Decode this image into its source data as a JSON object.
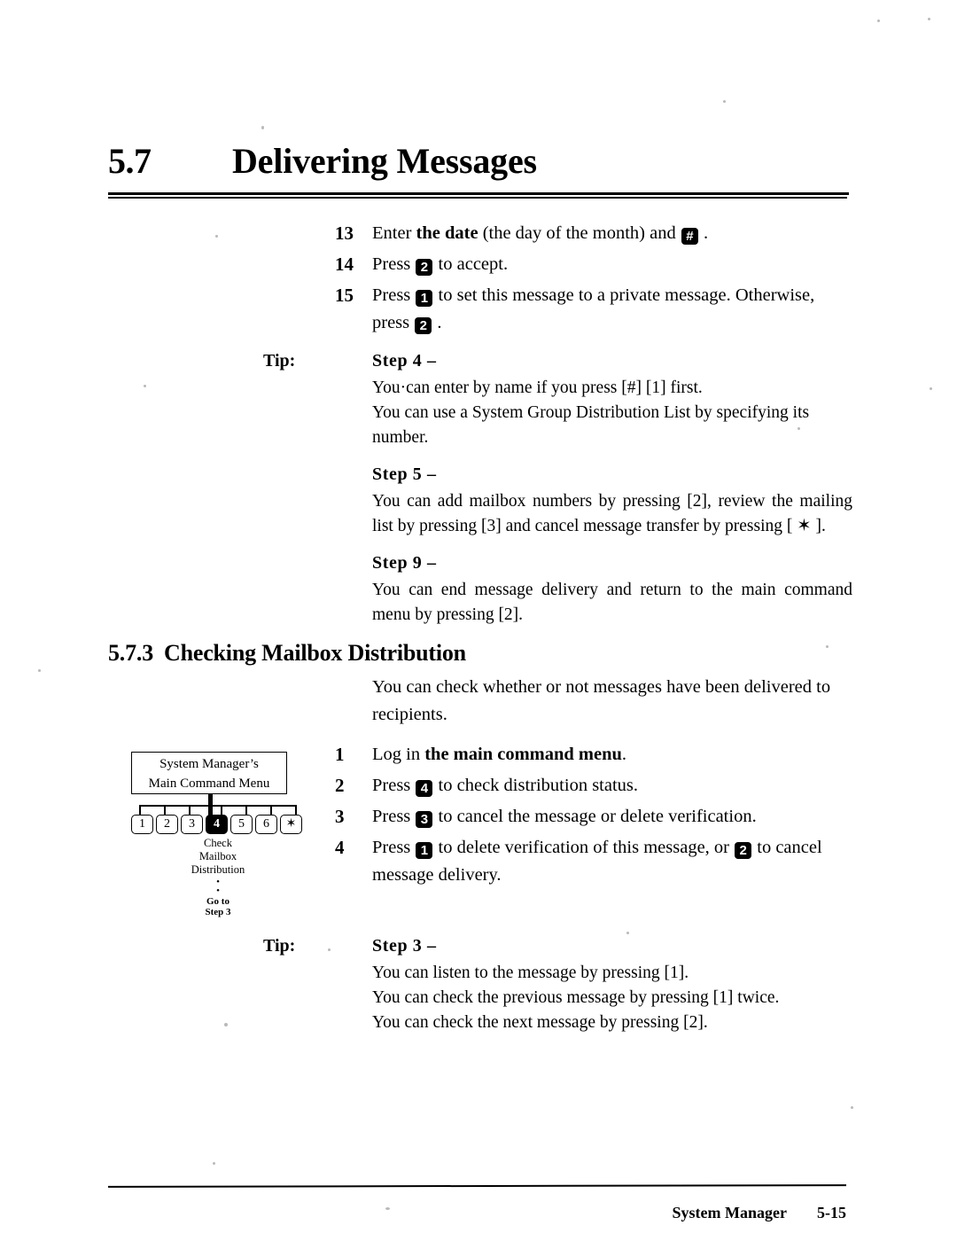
{
  "title": {
    "number": "5.7",
    "text": "Delivering Messages"
  },
  "steps_top": [
    {
      "num": "13",
      "parts": [
        {
          "t": "text",
          "v": "Enter "
        },
        {
          "t": "bold",
          "v": "the date"
        },
        {
          "t": "text",
          "v": " (the day of the month) and "
        },
        {
          "t": "key",
          "v": "#"
        },
        {
          "t": "text",
          "v": " ."
        }
      ]
    },
    {
      "num": "14",
      "parts": [
        {
          "t": "text",
          "v": "Press "
        },
        {
          "t": "key",
          "v": "2"
        },
        {
          "t": "text",
          "v": " to accept."
        }
      ]
    },
    {
      "num": "15",
      "parts": [
        {
          "t": "text",
          "v": "Press "
        },
        {
          "t": "key",
          "v": "1"
        },
        {
          "t": "text",
          "v": " to set this message to a private message.  Otherwise, press "
        },
        {
          "t": "key",
          "v": "2"
        },
        {
          "t": "text",
          "v": " ."
        }
      ]
    }
  ],
  "tip_top": {
    "label": "Tip:",
    "entries": [
      {
        "head": "Step  4  –",
        "paras": [
          "You·can enter by name if you press [#] [1] first.\nYou can use a System Group Distribution List by specifying its number."
        ]
      },
      {
        "head": "Step  5  –",
        "paras": [
          "You can add mailbox numbers by pressing [2], review the mailing list by pressing [3] and cancel message transfer by pressing [ ✶ ]."
        ]
      },
      {
        "head": "Step  9  –",
        "paras": [
          "You can end message delivery and return to the main command menu by pressing [2]."
        ]
      }
    ]
  },
  "subsection": {
    "number": "5.7.3",
    "title": "Checking Mailbox Distribution",
    "intro": "You can check whether or not messages have been delivered to recipients."
  },
  "diagram": {
    "box_line1": "System Manager’s",
    "box_line2": "Main Command Menu",
    "keys": [
      "1",
      "2",
      "3",
      "4",
      "5",
      "6",
      "✶"
    ],
    "selected_key": "4",
    "caption_line1": "Check",
    "caption_line2": "Mailbox",
    "caption_line3": "Distribution",
    "goto_line1": "Go to",
    "goto_line2": "Step 3"
  },
  "steps_bottom": [
    {
      "num": "1",
      "parts": [
        {
          "t": "text",
          "v": "Log in "
        },
        {
          "t": "bold",
          "v": "the main command menu"
        },
        {
          "t": "text",
          "v": "."
        }
      ]
    },
    {
      "num": "2",
      "parts": [
        {
          "t": "text",
          "v": "Press "
        },
        {
          "t": "key",
          "v": "4"
        },
        {
          "t": "text",
          "v": " to check distribution status."
        }
      ]
    },
    {
      "num": "3",
      "parts": [
        {
          "t": "text",
          "v": "Press "
        },
        {
          "t": "key",
          "v": "3"
        },
        {
          "t": "text",
          "v": " to cancel the message or delete verification."
        }
      ]
    },
    {
      "num": "4",
      "parts": [
        {
          "t": "text",
          "v": "Press "
        },
        {
          "t": "key",
          "v": "1"
        },
        {
          "t": "text",
          "v": " to delete verification of this message, or "
        },
        {
          "t": "key",
          "v": "2"
        },
        {
          "t": "text",
          "v": " to cancel message delivery."
        }
      ]
    }
  ],
  "tip_bottom": {
    "label": "Tip:",
    "entries": [
      {
        "head": "Step  3  –",
        "paras": [
          "You can listen to the message by pressing [1].\nYou can check the previous message by pressing [1] twice.\nYou can check the next message by pressing [2]."
        ]
      }
    ]
  },
  "footer": {
    "left": "System Manager",
    "right": "5-15"
  }
}
